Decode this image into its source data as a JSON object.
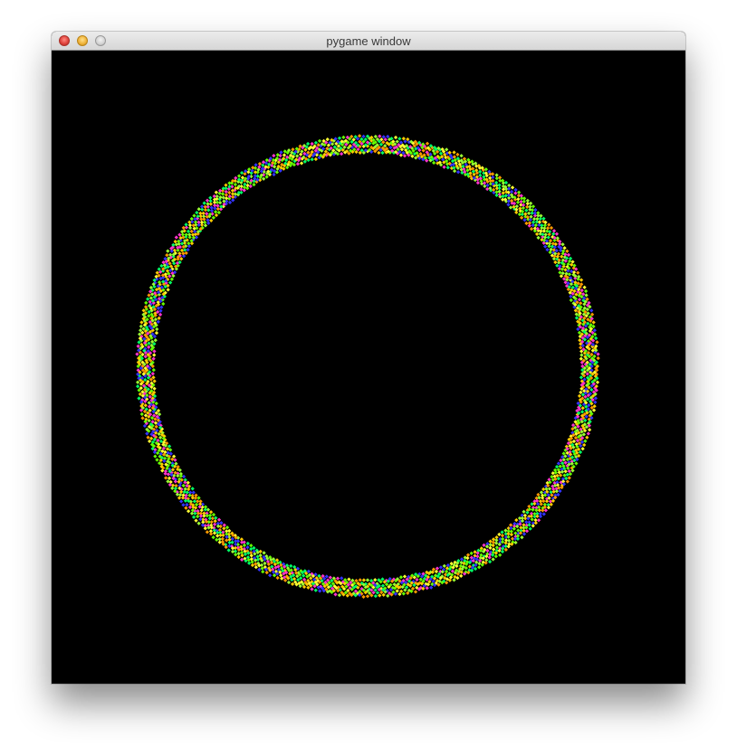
{
  "window": {
    "title": "pygame window",
    "controls": {
      "close": "close-button",
      "minimize": "minimize-button",
      "zoom": "zoom-button"
    }
  },
  "canvas": {
    "background": "#000000",
    "particle_palette": [
      "#66ff00",
      "#ffff33",
      "#ff33cc",
      "#3333ff",
      "#ff9900",
      "#99ff33",
      "#ffcc00",
      "#00ff66"
    ]
  }
}
